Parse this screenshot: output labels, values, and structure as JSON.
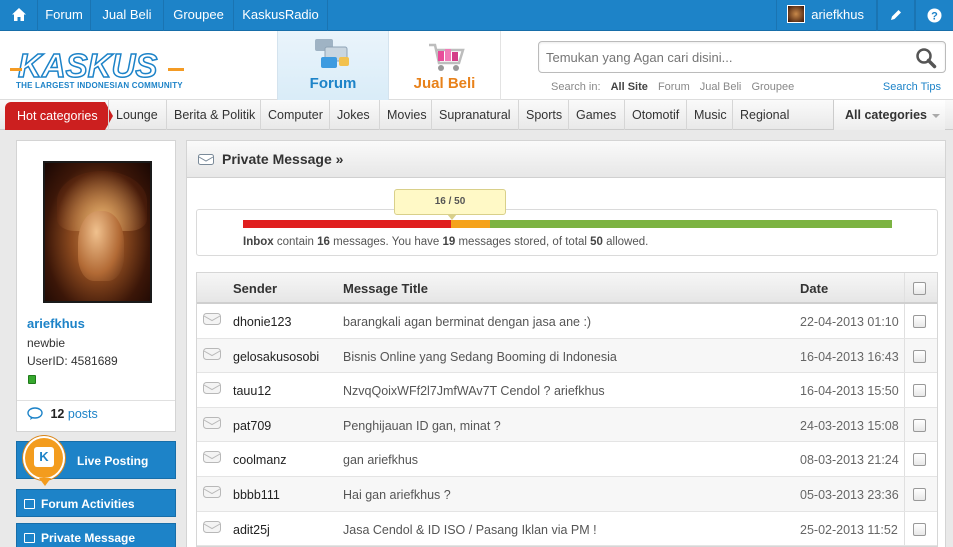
{
  "topbar": {
    "nav": [
      "Forum",
      "Jual Beli",
      "Groupee",
      "KaskusRadio"
    ],
    "username": "ariefkhus"
  },
  "header": {
    "logo_text": "KASKUS",
    "logo_tagline": "THE LARGEST INDONESIAN COMMUNITY",
    "tab_forum": "Forum",
    "tab_jualbeli": "Jual Beli",
    "search_placeholder": "Temukan yang Agan cari disini...",
    "search_in_label": "Search in:",
    "search_options": [
      "All Site",
      "Forum",
      "Jual Beli",
      "Groupee"
    ],
    "search_tips": "Search Tips"
  },
  "categories": {
    "hot": "Hot categories",
    "items": [
      "Lounge",
      "Berita & Politik",
      "Computer",
      "Jokes",
      "Movies",
      "Supranatural",
      "Sports",
      "Games",
      "Otomotif",
      "Music",
      "Regional"
    ],
    "all": "All categories"
  },
  "profile": {
    "username": "ariefkhus",
    "rank": "newbie",
    "userid": "UserID: 4581689",
    "posts_count": "12",
    "posts_label": "posts"
  },
  "sidebar_buttons": {
    "live": "Live Posting",
    "forum_activities": "Forum Activities",
    "private_message": "Private Message"
  },
  "pm": {
    "title": "Private Message »",
    "quota_bubble": "16 / 50",
    "quota_inbox_fraction": 0.32,
    "quota_stored_fraction": 0.38,
    "quota_text": {
      "inbox": "Inbox",
      "t1": " contain ",
      "n1": "16",
      "t2": " messages. You have ",
      "n2": "19",
      "t3": " messages stored, of total ",
      "n3": "50",
      "t4": " allowed."
    },
    "columns": [
      "Sender",
      "Message Title",
      "Date"
    ],
    "rows": [
      {
        "sender": "dhonie123",
        "title": "barangkali agan berminat dengan jasa ane :)",
        "date": "22-04-2013 01:10"
      },
      {
        "sender": "gelosakusosobi",
        "title": "Bisnis Online yang Sedang Booming di Indonesia",
        "date": "16-04-2013 16:43"
      },
      {
        "sender": "tauu12",
        "title": "NzvqQoixWFf2l7JmfWAv7T Cendol ? ariefkhus",
        "date": "16-04-2013 15:50"
      },
      {
        "sender": "pat709",
        "title": "Penghijauan ID gan, minat ?",
        "date": "24-03-2013 15:08"
      },
      {
        "sender": "coolmanz",
        "title": "gan ariefkhus",
        "date": "08-03-2013 21:24"
      },
      {
        "sender": "bbbb111",
        "title": "Hai gan ariefkhus ?",
        "date": "05-03-2013 23:36"
      },
      {
        "sender": "adit25j",
        "title": "Jasa Cendol & ID ISO / Pasang Iklan via PM !",
        "date": "25-02-2013 11:52"
      }
    ]
  },
  "colors": {
    "brand_blue": "#1d83c8",
    "hot_red": "#cc1f1f",
    "jualbeli_orange": "#e8821b",
    "quota_red": "#e01f1f",
    "quota_orange": "#f5a21b",
    "quota_green": "#7cb342"
  }
}
